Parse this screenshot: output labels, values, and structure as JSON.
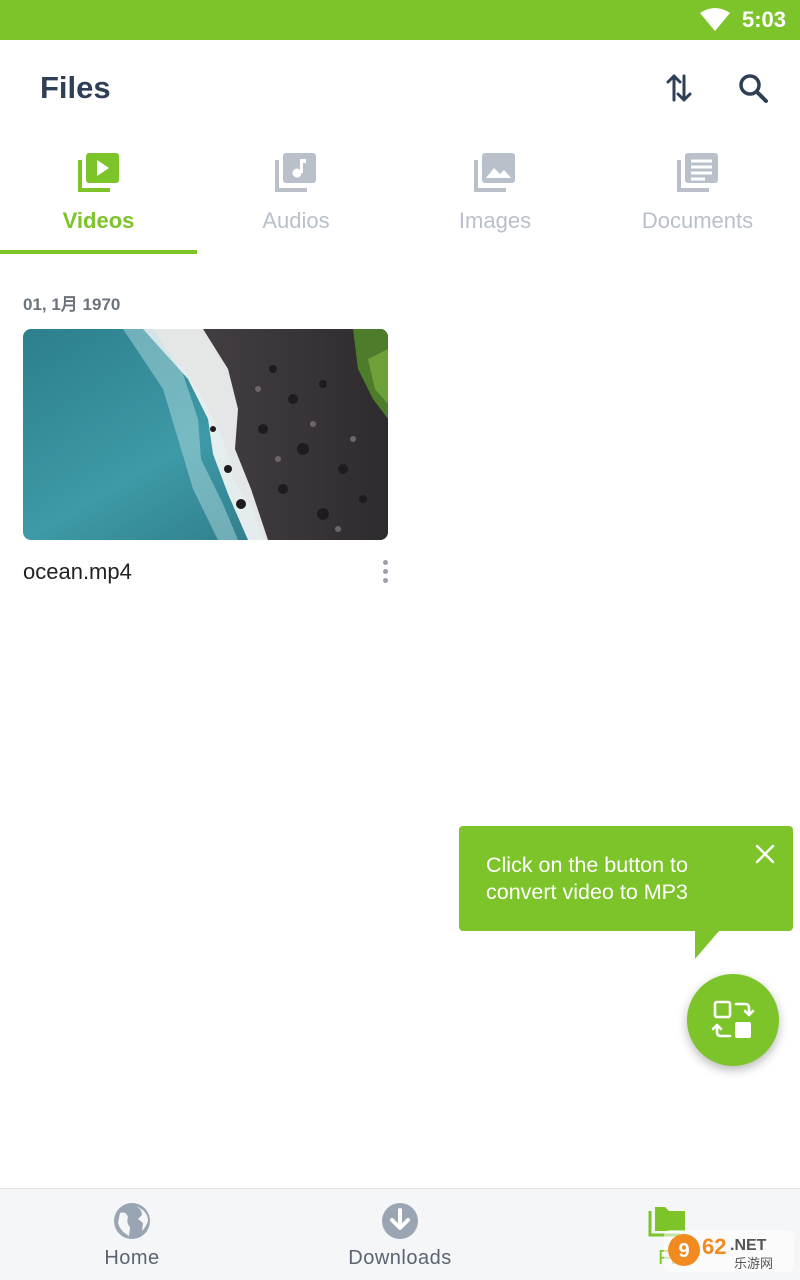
{
  "status_bar": {
    "time": "5:03"
  },
  "app_bar": {
    "title": "Files"
  },
  "tabs": [
    {
      "label": "Videos",
      "icon": "video-library-icon",
      "active": true
    },
    {
      "label": "Audios",
      "icon": "music-library-icon",
      "active": false
    },
    {
      "label": "Images",
      "icon": "image-library-icon",
      "active": false
    },
    {
      "label": "Documents",
      "icon": "document-library-icon",
      "active": false
    }
  ],
  "content": {
    "date_header": "01, 1月 1970",
    "videos": [
      {
        "name": "ocean.mp4"
      }
    ]
  },
  "tooltip": {
    "text": "Click on the button to convert video to MP3"
  },
  "bottom_nav": [
    {
      "label": "Home",
      "icon": "globe-icon",
      "active": false
    },
    {
      "label": "Downloads",
      "icon": "download-icon",
      "active": false
    },
    {
      "label": "Fi",
      "icon": "folder-icon",
      "active": true
    }
  ],
  "watermark": {
    "text": "962.NET",
    "subtext": "乐游网"
  },
  "colors": {
    "accent": "#7dc42a",
    "title": "#2f3f55",
    "inactive": "#b9c0ca"
  }
}
